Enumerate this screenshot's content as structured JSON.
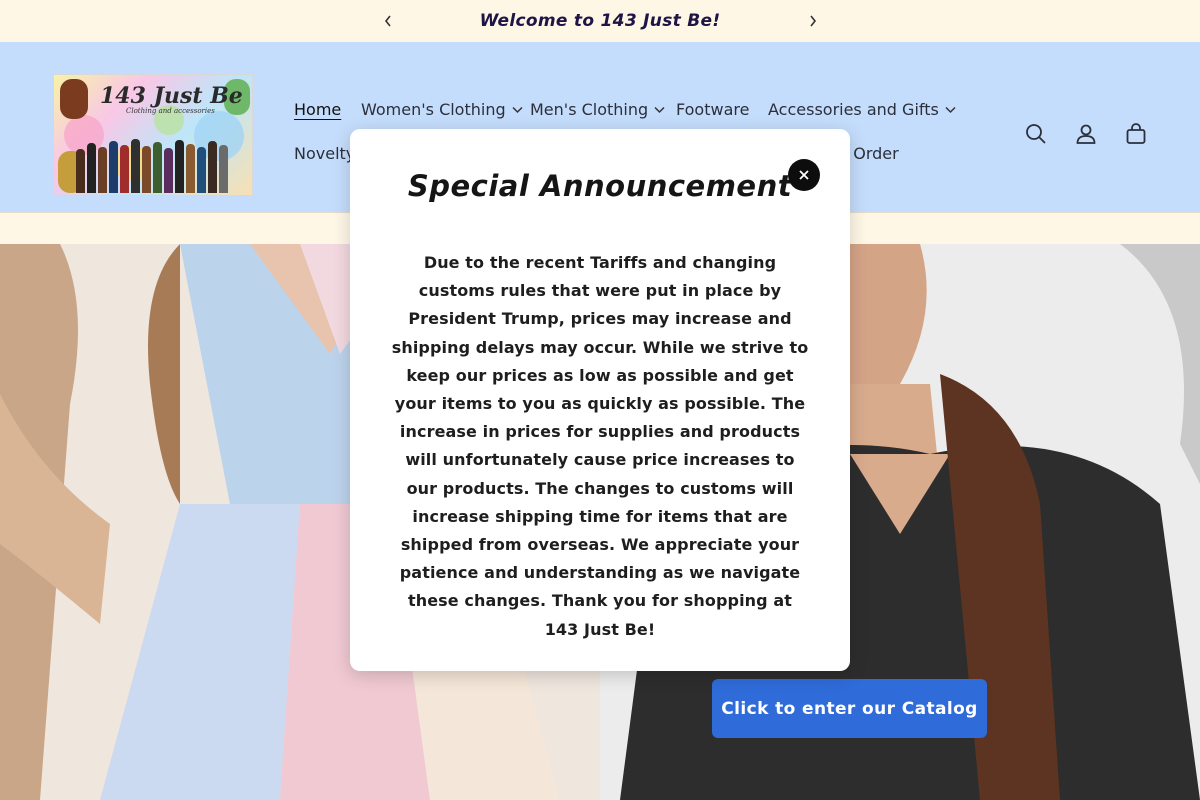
{
  "announcement": {
    "message": "Welcome to 143 Just Be!",
    "prev_icon": "chevron-left-icon",
    "next_icon": "chevron-right-icon"
  },
  "header": {
    "logo_text": "143 Just Be",
    "logo_subtext": "Clothing and accessories",
    "nav": [
      {
        "label": "Home",
        "active": true,
        "has_dropdown": false
      },
      {
        "label": "Women's Clothing",
        "has_dropdown": true
      },
      {
        "label": "Men's Clothing",
        "has_dropdown": true
      },
      {
        "label": "Footware",
        "has_dropdown": false
      },
      {
        "label": "Accessories and Gifts",
        "has_dropdown": true
      },
      {
        "label": "Novelty",
        "has_dropdown": false
      },
      {
        "label": "Your Order",
        "has_dropdown": false
      }
    ],
    "icons": [
      "search-icon",
      "account-icon",
      "cart-icon"
    ]
  },
  "modal": {
    "title": "Special Announcement",
    "body": "Due to the recent Tariffs and changing customs rules that were put in place by President Trump, prices may increase and shipping delays may occur. While we strive to keep our prices as low as possible and get your items to you as quickly as possible. The increase in prices for supplies and products will unfortunately cause price increases to our products. The changes to customs will increase shipping time for items that are shipped from overseas. We appreciate your patience and understanding as we navigate these changes. Thank you for shopping at 143 Just Be!",
    "close_icon": "close-icon"
  },
  "hero": {
    "cta_label": "Click to enter our Catalog"
  },
  "colors": {
    "announcement_bg": "#fff7e6",
    "header_bg": "#c5ddfc",
    "cta_bg": "#2f6bd9",
    "modal_bg": "#ffffff"
  }
}
